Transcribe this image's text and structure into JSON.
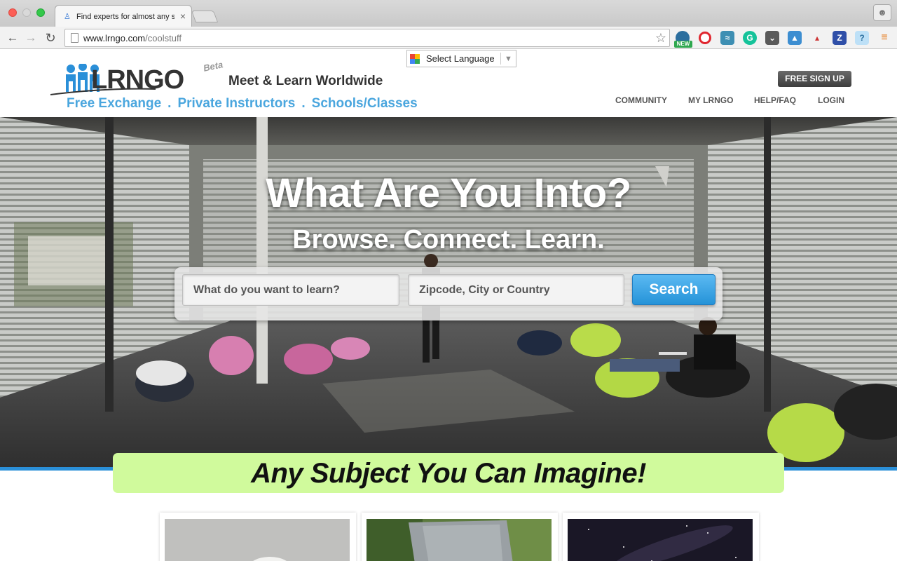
{
  "browser": {
    "tab_title": "Find experts for almost any su",
    "url_domain": "www.lrngo.com",
    "url_path": "/coolstuff",
    "extensions": [
      "new-badge-icon",
      "opera-icon",
      "feed-icon",
      "grammarly-icon",
      "pocket-icon",
      "bookmark-icon",
      "chart-icon",
      "zotero-icon",
      "help-icon",
      "menu-icon"
    ],
    "extension_badge": "NEW",
    "extension_letters": {
      "grammarly": "G",
      "zotero": "Z",
      "help": "?"
    }
  },
  "header": {
    "language_label": "Select Language",
    "logo_text": "LRNGO",
    "beta_label": "Beta",
    "tagline": "Meet & Learn Worldwide",
    "subnav": [
      "Free Exchange",
      "Private Instructors",
      "Schools/Classes"
    ],
    "subnav_separator": ".",
    "signup_label": "FREE SIGN UP",
    "nav": [
      "COMMUNITY",
      "MY LRNGO",
      "HELP/FAQ",
      "LOGIN"
    ]
  },
  "hero": {
    "title": "What Are You Into?",
    "subtitle": "Browse. Connect. Learn.",
    "search_placeholder": "What do you want to learn?",
    "location_placeholder": "Zipcode, City or Country",
    "search_button": "Search"
  },
  "banner": {
    "text": "Any Subject You Can Imagine!"
  },
  "colors": {
    "accent_blue": "#4aa6de",
    "banner_green": "#d0fa9c",
    "search_button": "#2593d8"
  }
}
